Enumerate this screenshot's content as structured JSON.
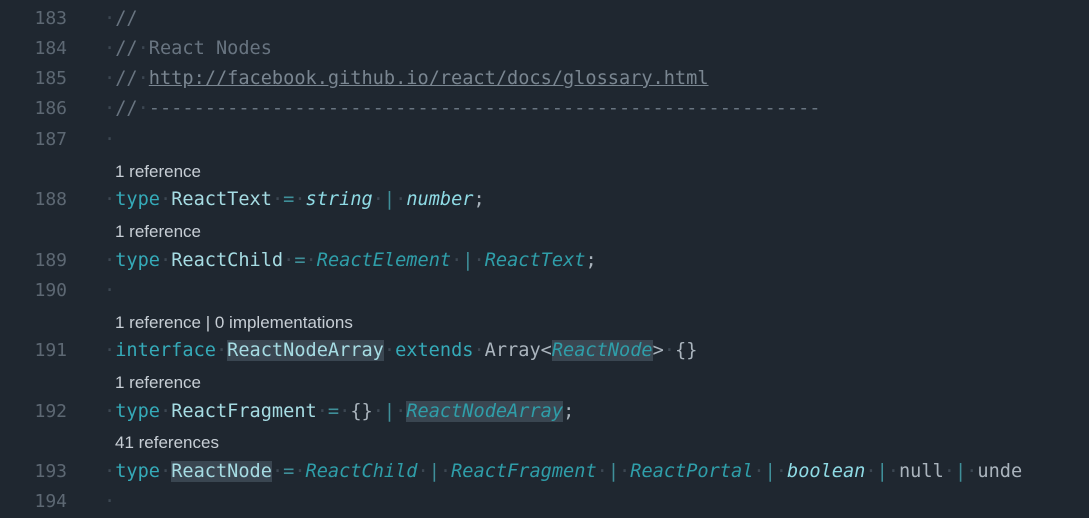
{
  "gutter": [
    "183",
    "184",
    "185",
    "186",
    "187",
    "188",
    "189",
    "190",
    "191",
    "192",
    "193",
    "194"
  ],
  "lenses": {
    "l188": "1 reference",
    "l189": "1 reference",
    "l191": "1 reference | 0 implementations",
    "l192": "1 reference",
    "l193": "41 references"
  },
  "code": {
    "l183": {
      "comment": "//"
    },
    "l184": {
      "slashes": "//",
      "text": "React Nodes"
    },
    "l185": {
      "slashes": "//",
      "url": "http://facebook.github.io/react/docs/glossary.html"
    },
    "l186": {
      "slashes": "//",
      "dashes": "------------------------------------------------------------"
    },
    "l188": {
      "kw": "type",
      "name": "ReactText",
      "eq": "=",
      "t1": "string",
      "bar": "|",
      "t2": "number",
      "semi": ";"
    },
    "l189": {
      "kw": "type",
      "name": "ReactChild",
      "eq": "=",
      "t1": "ReactElement",
      "bar": "|",
      "t2": "ReactText",
      "semi": ";"
    },
    "l191": {
      "kw": "interface",
      "name": "ReactNodeArray",
      "kw2": "extends",
      "base": "Array<",
      "arg": "ReactNode",
      "close": ">",
      "body": "{}"
    },
    "l192": {
      "kw": "type",
      "name": "ReactFragment",
      "eq": "=",
      "t1": "{}",
      "bar": "|",
      "t2": "ReactNodeArray",
      "semi": ";"
    },
    "l193": {
      "kw": "type",
      "name": "ReactNode",
      "eq": "=",
      "t1": "ReactChild",
      "b1": "|",
      "t2": "ReactFragment",
      "b2": "|",
      "t3": "ReactPortal",
      "b3": "|",
      "t4": "boolean",
      "b4": "|",
      "t5": "null",
      "b5": "|",
      "t6": "unde"
    }
  }
}
